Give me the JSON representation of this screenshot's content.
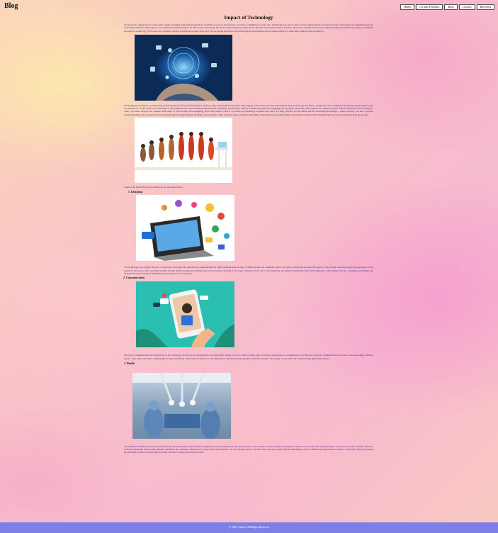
{
  "header": {
    "blog_title": "Blog",
    "nav": [
      "Home",
      "CS and Portfolio",
      "Blog",
      "Contact",
      "Research"
    ]
  },
  "article": {
    "title": "Impact of Technology",
    "intro": "Technology is simply known as the sum of skills, techniques and method used in the production of goods and services to produce something new every day. Technology can also be said as never ending updates. In today's world, every people are dependent upon the technology. Without technology it is very difficult for human being to do their works. Technology has made a great change in today's world. The use of electronic devices and their connections through various networking mediums has made it impossible to determine the future of technology. With every new invention our life is getting more busy and social. We are getting addicted to the technological advancement and becoming unable to a small thing without using technology.",
    "impact_paragraph": "Technology has an impact on human life by introducing new threats and benefits to our lives. New technologies have been a huge support in the classroom and in the medical field. Technology also plays a significant role in workplace monitoring, which many people are unaware of. In the classroom, technological developments have been beneficial.Students like technology because they believe it makes learning more engaging and enjoyable, especially when laptops and tablets are used. Virtual education, such as through a video, can make subjects that students find tough or even boring more intriguing. Since this modern world is so reliant on technology, students who use it are fully prepared for the future and for developing knowledge - based economy. It's also a popular misunderstanding among students that technology improves their memory. Students can now learn at their own pace due to modern technologies. The technology has both positive and negative impacts which depends upon the use of technology done by the user.",
    "fields_intro": "Some of the fields affected by technology are described below:",
    "sections": [
      {
        "heading": "1. Education",
        "text": "The technology has changed the way of education. Nowadays the students are taught through the digital medium with the help of smart phones and computers. There are online schools that provides the degree to the student without the physical appearance of the student in the school. The e-learning modules and the online learning opportunities has been increased. Learning is no longer confined in four wall of the institution and physical boundaries aren't much important today. Online schools, e-learning programmes and educational content brings in flexibility and convenience for the students."
      },
      {
        "heading": "2. Communication",
        "text": "The way of communication is changed due to the technology. In the past, the people have to be physically present or have to wait for many days to receive a single letter to communicate. The different electronic communication tools like social networking websites, emails, voice mails, and video conferencing has been introduced. Such tools be useful to to save time.mand communicate with people in very few seconds. The people can see each other without being physically present."
      },
      {
        "heading": "3. Health",
        "text": "The healthcare industry has been greatly influenced by technological advancements. Diagnostic tools have improved, allowing doctors to detect health concerns earlier, increasing the chances of successful life-saving therapies. Vaccines have been extremely effective, virtually eliminating illnesses like measles, diphtheria, and smallpox, which used to cause major crises.Patients can now manage chronic disorders that were once painful and life-threatening, such as diabetes and hypertension, thanks to technology. Medical progress has extended people's lives and improved their standard of living all across the world."
      }
    ]
  },
  "footer": {
    "text": "© 2022, Ashish | All Rights Reserved"
  },
  "colors": {
    "footer_bg": "#7d7fe6",
    "body_text": "#3a2b7a",
    "tech_image_bg": "#0b2a55",
    "communication_image_bg": "#2bbfb1",
    "health_image_bg": "#8aa4bf"
  }
}
